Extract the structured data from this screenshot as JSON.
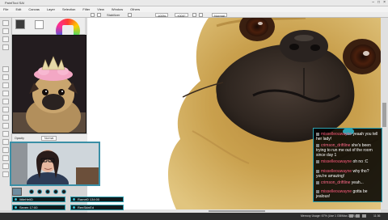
{
  "app": {
    "title": "PaintTool SAI",
    "window_buttons": [
      "–",
      "□",
      "×"
    ]
  },
  "menu": [
    "File",
    "Edit",
    "Canvas",
    "Layer",
    "Selection",
    "Filter",
    "View",
    "Window",
    "Others"
  ],
  "toolbar": {
    "stabilizer_label": "Stabilizer",
    "zoom": "100%",
    "angle": "+000°",
    "rotate_label": "Rotate",
    "view_label": "Normal"
  },
  "layers": {
    "blend_label": "Opacity",
    "mode_value": "Normal"
  },
  "overlay": {
    "dots": 5,
    "bar1": "littleHeliD",
    "bar2": "Ramel0 134:00",
    "bar3": "Seven 17:00",
    "bar4": "RenSkinEd"
  },
  "chat": {
    "messages": [
      {
        "user": "misselleouwayne",
        "text": "yeaah you tell her lady!"
      },
      {
        "user": "crimson_driftline",
        "text": "she's been trying to run me out of the room since day 1"
      },
      {
        "user": "misselleouwayne",
        "text": "oh no :C"
      },
      {
        "user": "misselleouwayne",
        "text": "why tho? you're amazing!"
      },
      {
        "user": "crimson_driftline",
        "text": "yeah..."
      },
      {
        "user": "misselleouwayne",
        "text": "gotta be jealous!"
      }
    ]
  },
  "status": {
    "left": "Memory Usage: 67% (Use 1 GB/Max 2 GB)",
    "time": "11:36"
  },
  "colors": {
    "accent": "#2da3b2",
    "chat_user": "#ff5b7d",
    "pug_fur": "#c99a3e"
  }
}
